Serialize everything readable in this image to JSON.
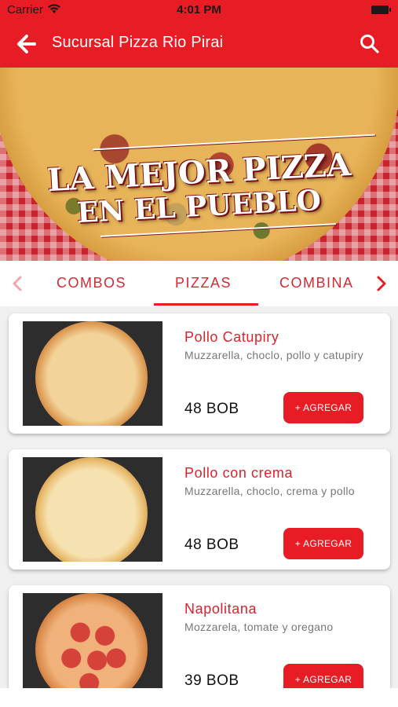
{
  "status_bar": {
    "carrier": "Carrier",
    "time": "4:01 PM"
  },
  "header": {
    "title": "Sucursal Pizza Rio Pirai",
    "back_icon": "arrow-left-icon",
    "search_icon": "search-icon"
  },
  "banner": {
    "line1": "La Mejor Pizza",
    "line2": "en el Pueblo"
  },
  "tabs": {
    "items": [
      {
        "label": "COMBOS",
        "selected": false
      },
      {
        "label": "PIZZAS",
        "selected": true
      },
      {
        "label": "COMBINA",
        "selected": false
      }
    ]
  },
  "products": [
    {
      "name": "Pollo Catupiry",
      "description": "Muzzarella, choclo, pollo y catupiry",
      "price": "48 BOB",
      "button": "+ AGREGAR"
    },
    {
      "name": "Pollo con crema",
      "description": "Muzzarella, choclo, crema y pollo",
      "price": "48 BOB",
      "button": "+ AGREGAR"
    },
    {
      "name": "Napolitana",
      "description": "Mozzarela, tomate y oregano",
      "price": "39 BOB",
      "button": "+ AGREGAR"
    }
  ],
  "colors": {
    "brand": "#e81c24",
    "tab_text": "#d42a32",
    "background": "#f0f0f0"
  }
}
